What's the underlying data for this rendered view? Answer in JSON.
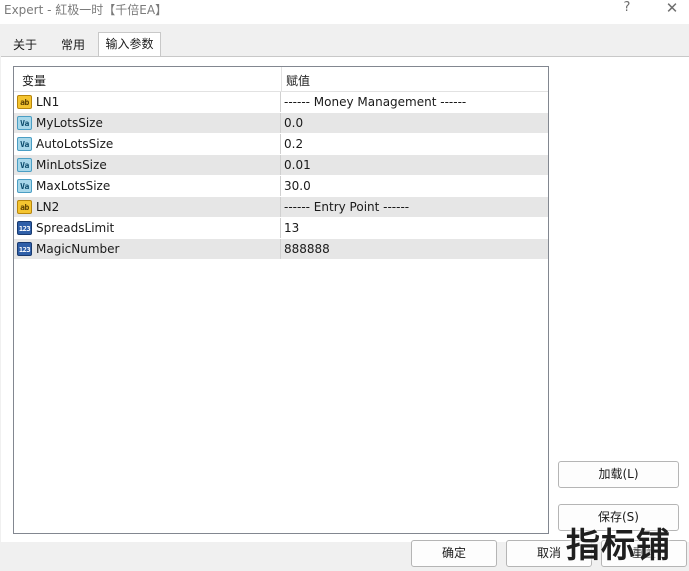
{
  "window": {
    "title": "Expert - 紅极一时【千倍EA】",
    "help_glyph": "?",
    "close_glyph": "✕"
  },
  "tabs": [
    {
      "label": "关于",
      "active": false
    },
    {
      "label": "常用",
      "active": false
    },
    {
      "label": "输入参数",
      "active": true
    }
  ],
  "table": {
    "headers": {
      "name": "变量",
      "value": "赋值"
    },
    "rows": [
      {
        "icon": "string-icon",
        "icon_text": "ab",
        "name": "LN1",
        "value": "------ Money Management ------"
      },
      {
        "icon": "double-icon",
        "icon_text": "Va",
        "name": "MyLotsSize",
        "value": "0.0"
      },
      {
        "icon": "double-icon",
        "icon_text": "Va",
        "name": "AutoLotsSize",
        "value": "0.2"
      },
      {
        "icon": "double-icon",
        "icon_text": "Va",
        "name": "MinLotsSize",
        "value": "0.01"
      },
      {
        "icon": "double-icon",
        "icon_text": "Va",
        "name": "MaxLotsSize",
        "value": "30.0"
      },
      {
        "icon": "string-icon",
        "icon_text": "ab",
        "name": "LN2",
        "value": "------ Entry Point ------"
      },
      {
        "icon": "integer-icon",
        "icon_text": "123",
        "name": "SpreadsLimit",
        "value": "13"
      },
      {
        "icon": "integer-icon",
        "icon_text": "123",
        "name": "MagicNumber",
        "value": "888888"
      }
    ]
  },
  "buttons": {
    "load": "加载(L)",
    "save": "保存(S)",
    "ok": "确定",
    "cancel": "取消",
    "reset": "重置"
  },
  "watermark": "指标铺"
}
